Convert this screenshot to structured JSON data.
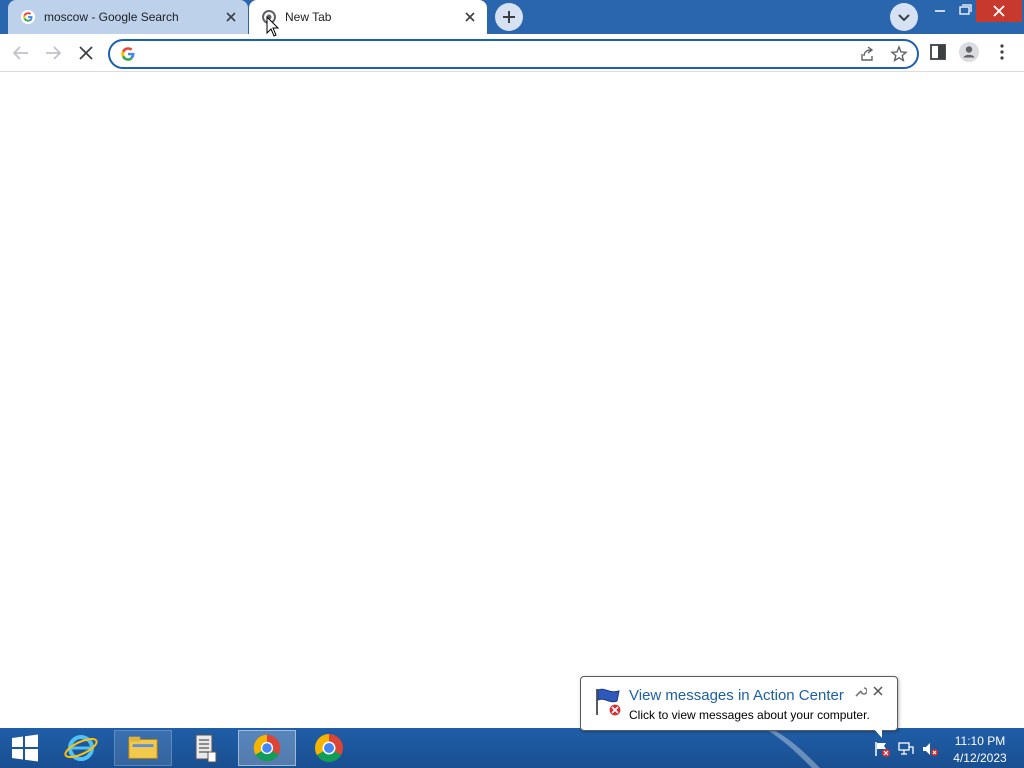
{
  "browser": {
    "tabs": [
      {
        "title": "moscow - Google Search",
        "favicon": "google-g-icon",
        "state": "inactive"
      },
      {
        "title": "New Tab",
        "favicon": "loading-spinner-icon",
        "state": "active"
      }
    ],
    "new_tab_icon": "plus-icon",
    "tab_search_icon": "chevron-down-icon",
    "window_controls": [
      "minimize-icon",
      "restore-icon",
      "close-icon"
    ],
    "toolbar": {
      "back_icon": "back-arrow-icon",
      "forward_icon": "forward-arrow-icon",
      "stop_icon": "stop-x-icon",
      "address_value": "",
      "right_icons": [
        "share-icon",
        "bookmark-star-icon",
        "side-panel-icon",
        "profile-icon",
        "menu-kebab-icon"
      ]
    }
  },
  "notification": {
    "title": "View messages in Action Center",
    "body": "Click to view messages about your computer."
  },
  "taskbar": {
    "apps": [
      "start-button",
      "internet-explorer-icon",
      "file-explorer-icon",
      "server-manager-icon",
      "chrome-icon",
      "chrome-icon"
    ],
    "clock_time": "11:10 PM",
    "clock_date": "4/12/2023"
  },
  "colors": {
    "tabstrip": "#2a66ae",
    "omnibox_focus": "#1a5fb4",
    "taskbar": "#1f5ea8",
    "close_red": "#c7392c"
  }
}
